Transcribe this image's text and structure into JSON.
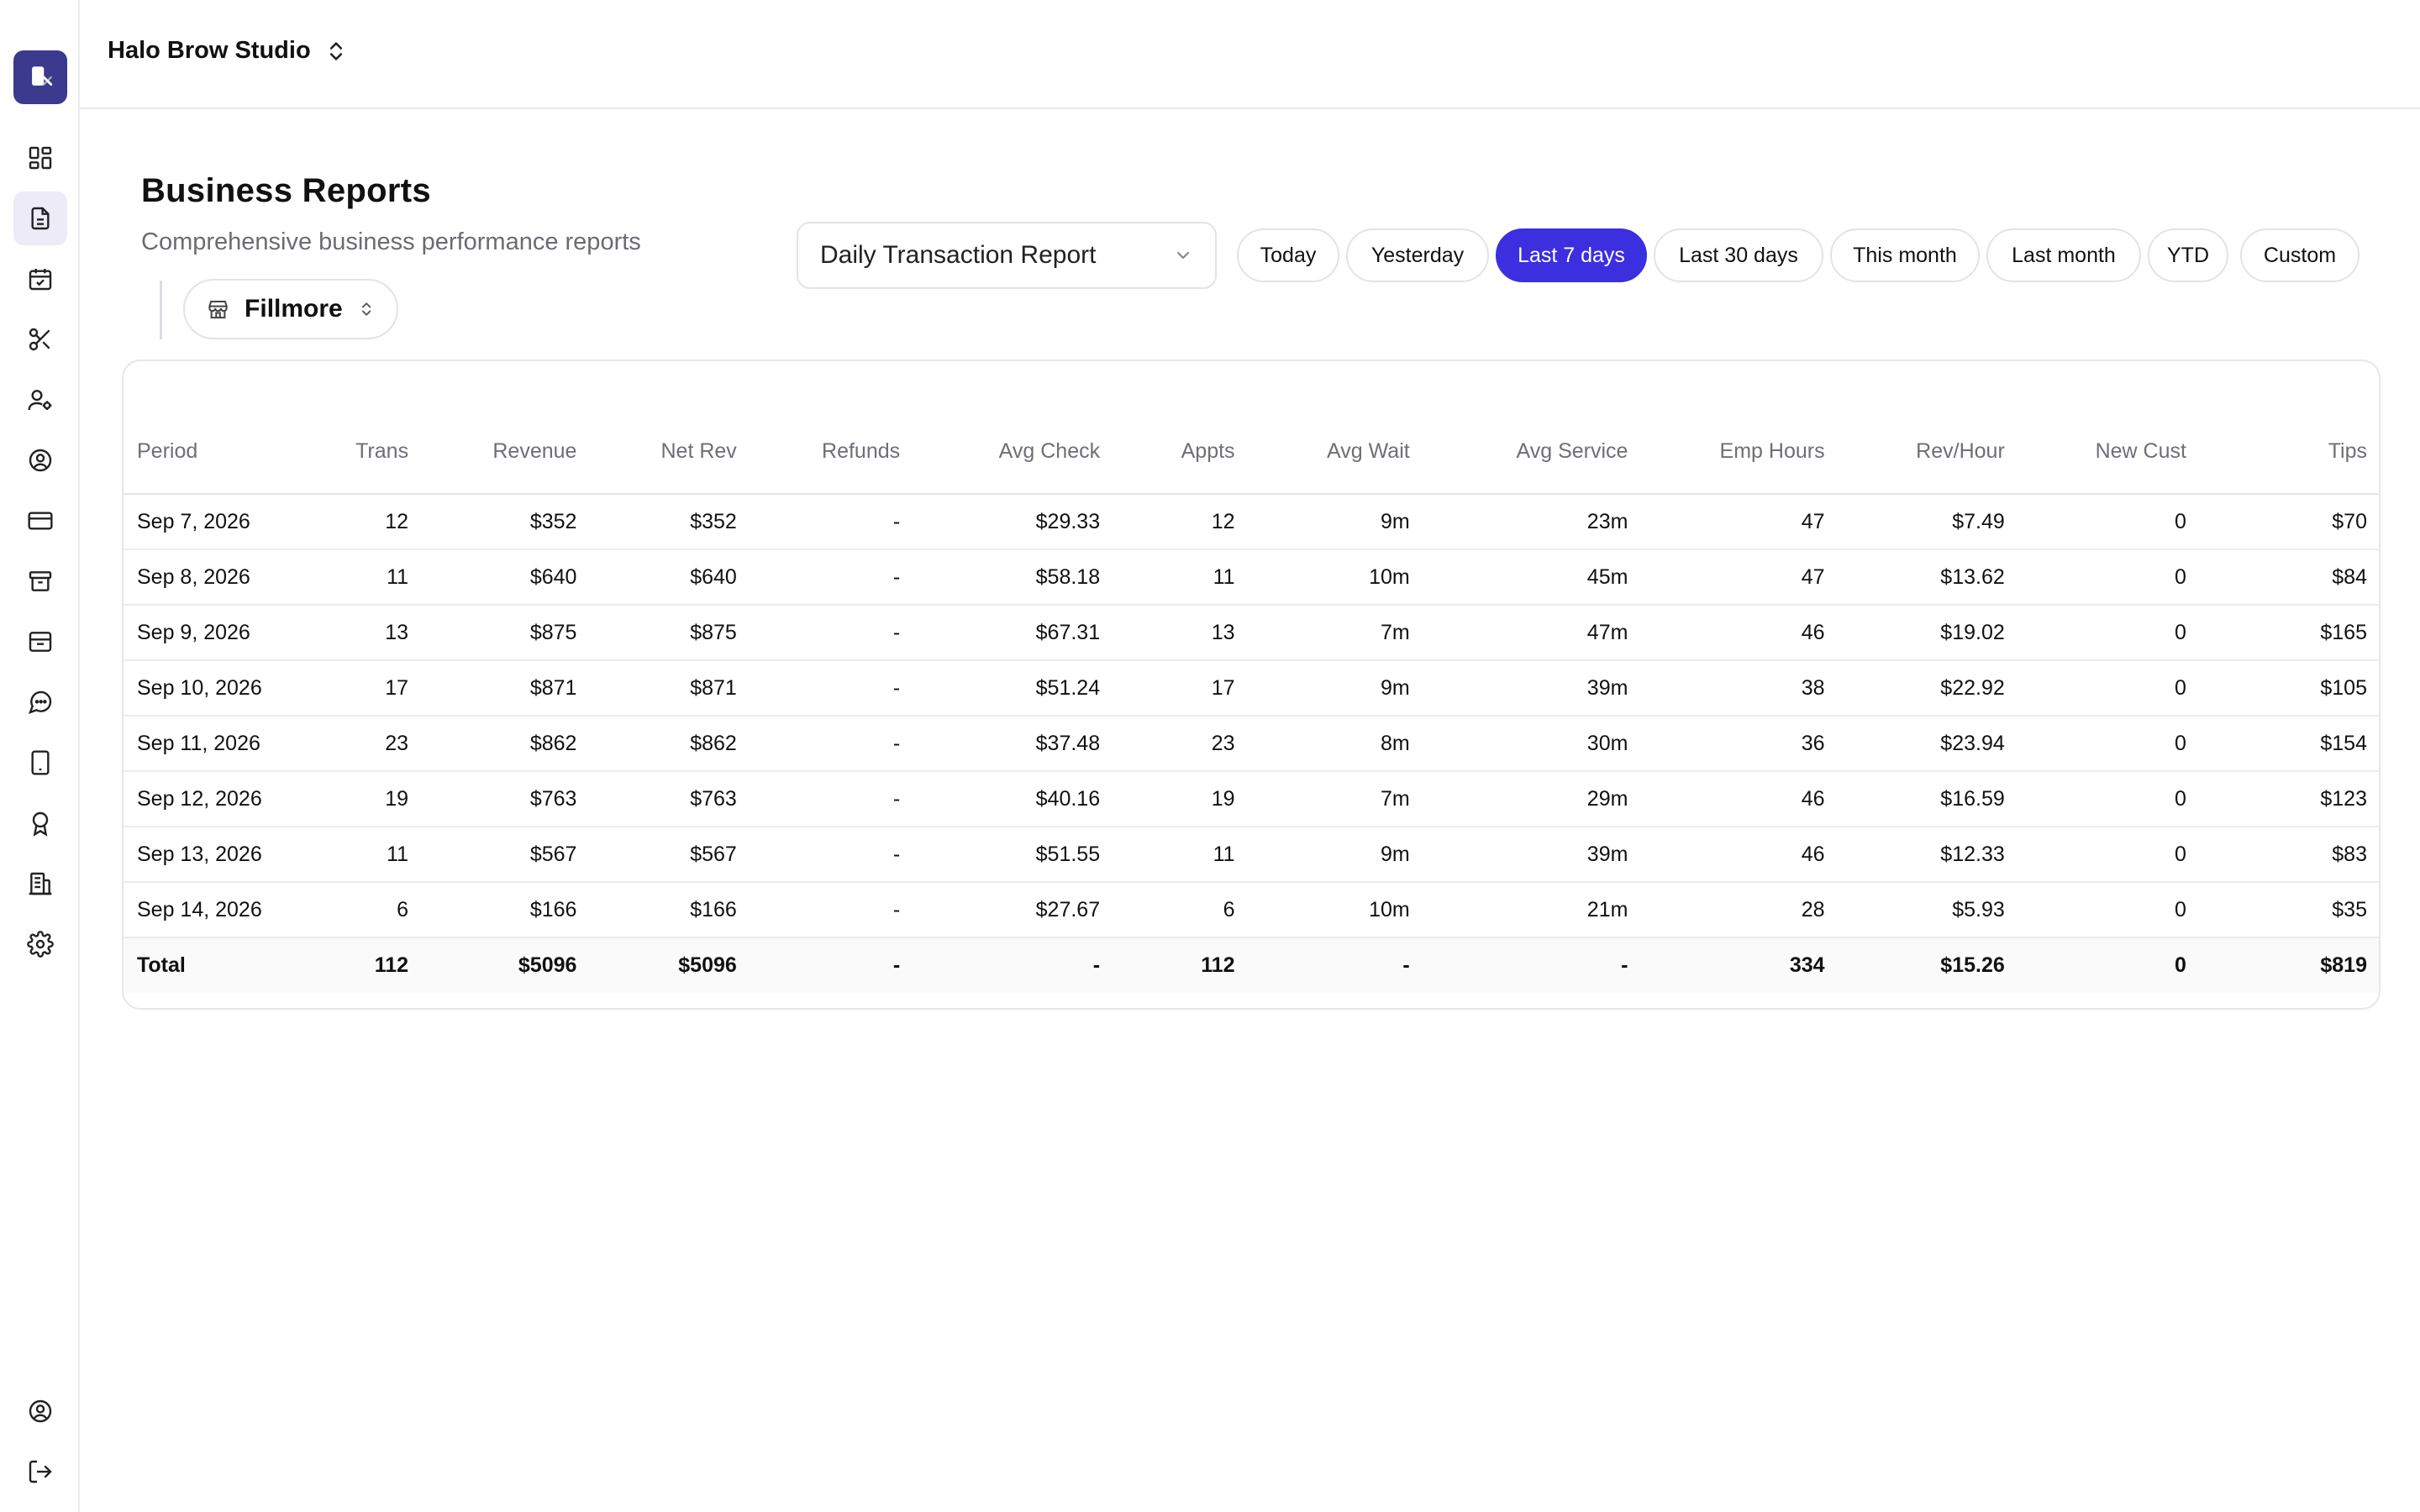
{
  "studio": {
    "name": "Halo Brow Studio"
  },
  "header": {
    "title": "Business Reports",
    "subtitle": "Comprehensive business performance reports"
  },
  "location": {
    "selected": "Fillmore"
  },
  "report": {
    "selected": "Daily Transaction Report"
  },
  "date_ranges": [
    {
      "label": "Today",
      "active": false
    },
    {
      "label": "Yesterday",
      "active": false
    },
    {
      "label": "Last 7 days",
      "active": true
    },
    {
      "label": "Last 30 days",
      "active": false
    },
    {
      "label": "This month",
      "active": false
    },
    {
      "label": "Last month",
      "active": false
    },
    {
      "label": "YTD",
      "active": false
    },
    {
      "label": "Custom",
      "active": false
    }
  ],
  "sidebar": {
    "items": [
      {
        "icon": "dashboard-icon",
        "active": false
      },
      {
        "icon": "reports-icon",
        "active": true
      },
      {
        "icon": "calendar-icon",
        "active": false
      },
      {
        "icon": "scissors-icon",
        "active": false
      },
      {
        "icon": "staff-icon",
        "active": false
      },
      {
        "icon": "customer-icon",
        "active": false
      },
      {
        "icon": "credit-card-icon",
        "active": false
      },
      {
        "icon": "inventory-icon",
        "active": false
      },
      {
        "icon": "archive-icon",
        "active": false
      },
      {
        "icon": "messages-icon",
        "active": false
      },
      {
        "icon": "tablet-icon",
        "active": false
      },
      {
        "icon": "award-icon",
        "active": false
      },
      {
        "icon": "building-icon",
        "active": false
      },
      {
        "icon": "settings-icon",
        "active": false
      }
    ],
    "bottom": [
      {
        "icon": "account-icon"
      },
      {
        "icon": "logout-icon"
      }
    ]
  },
  "table": {
    "columns": [
      "Period",
      "Trans",
      "Revenue",
      "Net Rev",
      "Refunds",
      "Avg Check",
      "Appts",
      "Avg Wait",
      "Avg Service",
      "Emp Hours",
      "Rev/Hour",
      "New Cust",
      "Tips"
    ],
    "rows": [
      [
        "Sep 7, 2026",
        "12",
        "$352",
        "$352",
        "-",
        "$29.33",
        "12",
        "9m",
        "23m",
        "47",
        "$7.49",
        "0",
        "$70"
      ],
      [
        "Sep 8, 2026",
        "11",
        "$640",
        "$640",
        "-",
        "$58.18",
        "11",
        "10m",
        "45m",
        "47",
        "$13.62",
        "0",
        "$84"
      ],
      [
        "Sep 9, 2026",
        "13",
        "$875",
        "$875",
        "-",
        "$67.31",
        "13",
        "7m",
        "47m",
        "46",
        "$19.02",
        "0",
        "$165"
      ],
      [
        "Sep 10, 2026",
        "17",
        "$871",
        "$871",
        "-",
        "$51.24",
        "17",
        "9m",
        "39m",
        "38",
        "$22.92",
        "0",
        "$105"
      ],
      [
        "Sep 11, 2026",
        "23",
        "$862",
        "$862",
        "-",
        "$37.48",
        "23",
        "8m",
        "30m",
        "36",
        "$23.94",
        "0",
        "$154"
      ],
      [
        "Sep 12, 2026",
        "19",
        "$763",
        "$763",
        "-",
        "$40.16",
        "19",
        "7m",
        "29m",
        "46",
        "$16.59",
        "0",
        "$123"
      ],
      [
        "Sep 13, 2026",
        "11",
        "$567",
        "$567",
        "-",
        "$51.55",
        "11",
        "9m",
        "39m",
        "46",
        "$12.33",
        "0",
        "$83"
      ],
      [
        "Sep 14, 2026",
        "6",
        "$166",
        "$166",
        "-",
        "$27.67",
        "6",
        "10m",
        "21m",
        "28",
        "$5.93",
        "0",
        "$35"
      ]
    ],
    "total": [
      "Total",
      "112",
      "$5096",
      "$5096",
      "-",
      "-",
      "112",
      "-",
      "-",
      "334",
      "$15.26",
      "0",
      "$819"
    ]
  },
  "colors": {
    "accent": "#3b2fe0",
    "logo_bg": "#3b3a8f"
  }
}
